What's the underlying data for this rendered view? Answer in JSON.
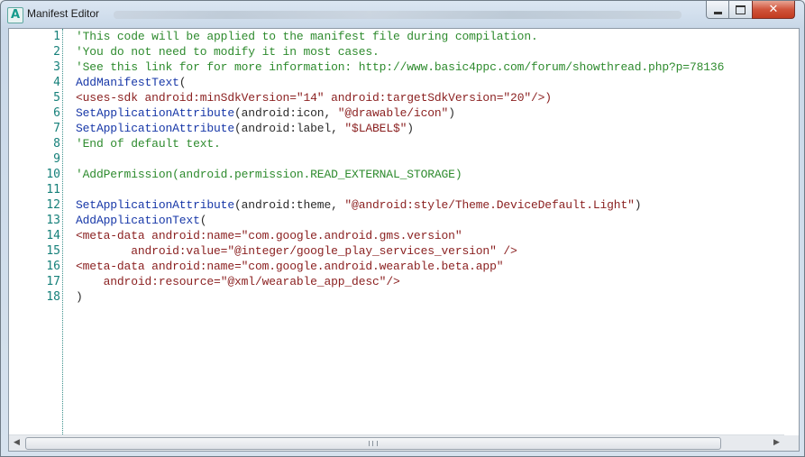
{
  "window": {
    "title": "Manifest Editor",
    "icon_letter": "A",
    "icon": "app-icon",
    "buttons": {
      "minimize": "minimize-icon",
      "maximize": "maximize-icon",
      "close": "close-icon"
    },
    "close_glyph": "✕"
  },
  "editor": {
    "lines": [
      {
        "n": "1",
        "segments": [
          {
            "t": "'This code will be applied to the manifest file during compilation.",
            "c": "comment"
          }
        ]
      },
      {
        "n": "2",
        "segments": [
          {
            "t": "'You do not need to modify it in most cases.",
            "c": "comment"
          }
        ]
      },
      {
        "n": "3",
        "segments": [
          {
            "t": "'See this link for for more information: http://www.basic4ppc.com/forum/showthread.php?p=78136",
            "c": "comment"
          }
        ]
      },
      {
        "n": "4",
        "segments": [
          {
            "t": "AddManifestText",
            "c": "keyword"
          },
          {
            "t": "(",
            "c": "plain"
          }
        ]
      },
      {
        "n": "5",
        "segments": [
          {
            "t": "<uses-sdk android:minSdkVersion=",
            "c": "string"
          },
          {
            "t": "\"14\"",
            "c": "string"
          },
          {
            "t": " android:targetSdkVersion=",
            "c": "string"
          },
          {
            "t": "\"20\"",
            "c": "string"
          },
          {
            "t": "/>)",
            "c": "string"
          }
        ]
      },
      {
        "n": "6",
        "segments": [
          {
            "t": "SetApplicationAttribute",
            "c": "keyword"
          },
          {
            "t": "(android:icon, ",
            "c": "plain"
          },
          {
            "t": "\"@drawable/icon\"",
            "c": "string"
          },
          {
            "t": ")",
            "c": "plain"
          }
        ]
      },
      {
        "n": "7",
        "segments": [
          {
            "t": "SetApplicationAttribute",
            "c": "keyword"
          },
          {
            "t": "(android:label, ",
            "c": "plain"
          },
          {
            "t": "\"$LABEL$\"",
            "c": "string"
          },
          {
            "t": ")",
            "c": "plain"
          }
        ]
      },
      {
        "n": "8",
        "segments": [
          {
            "t": "'End of default text.",
            "c": "comment"
          }
        ]
      },
      {
        "n": "9",
        "segments": []
      },
      {
        "n": "10",
        "segments": [
          {
            "t": "'AddPermission(android.permission.READ_EXTERNAL_STORAGE)",
            "c": "comment"
          }
        ]
      },
      {
        "n": "11",
        "segments": []
      },
      {
        "n": "12",
        "segments": [
          {
            "t": "SetApplicationAttribute",
            "c": "keyword"
          },
          {
            "t": "(android:theme, ",
            "c": "plain"
          },
          {
            "t": "\"@android:style/Theme.DeviceDefault.Light\"",
            "c": "string"
          },
          {
            "t": ")",
            "c": "plain"
          }
        ]
      },
      {
        "n": "13",
        "segments": [
          {
            "t": "AddApplicationText",
            "c": "keyword"
          },
          {
            "t": "(",
            "c": "plain"
          }
        ]
      },
      {
        "n": "14",
        "segments": [
          {
            "t": "<meta-data android:name=",
            "c": "string"
          },
          {
            "t": "\"com.google.android.gms.version\"",
            "c": "string"
          }
        ]
      },
      {
        "n": "15",
        "segments": [
          {
            "t": "        android:value=",
            "c": "string"
          },
          {
            "t": "\"@integer/google_play_services_version\"",
            "c": "string"
          },
          {
            "t": " />",
            "c": "string"
          }
        ]
      },
      {
        "n": "16",
        "segments": [
          {
            "t": "<meta-data android:name=",
            "c": "string"
          },
          {
            "t": "\"com.google.android.wearable.beta.app\"",
            "c": "string"
          }
        ]
      },
      {
        "n": "17",
        "segments": [
          {
            "t": "    android:resource=",
            "c": "string"
          },
          {
            "t": "\"@xml/wearable_app_desc\"",
            "c": "string"
          },
          {
            "t": "/>",
            "c": "string"
          }
        ]
      },
      {
        "n": "18",
        "segments": [
          {
            "t": ")",
            "c": "plain"
          }
        ]
      }
    ]
  },
  "scrollbar": {
    "left_arrow": "◀",
    "right_arrow": "▶",
    "icons": [
      "scroll-left-icon",
      "scroll-right-icon",
      "grip-icon"
    ]
  },
  "colors": {
    "comment": "#2e8b2e",
    "keyword": "#1838a8",
    "string": "#8a1f1f",
    "line_number": "#16807a",
    "close_button": "#c23a1f"
  }
}
